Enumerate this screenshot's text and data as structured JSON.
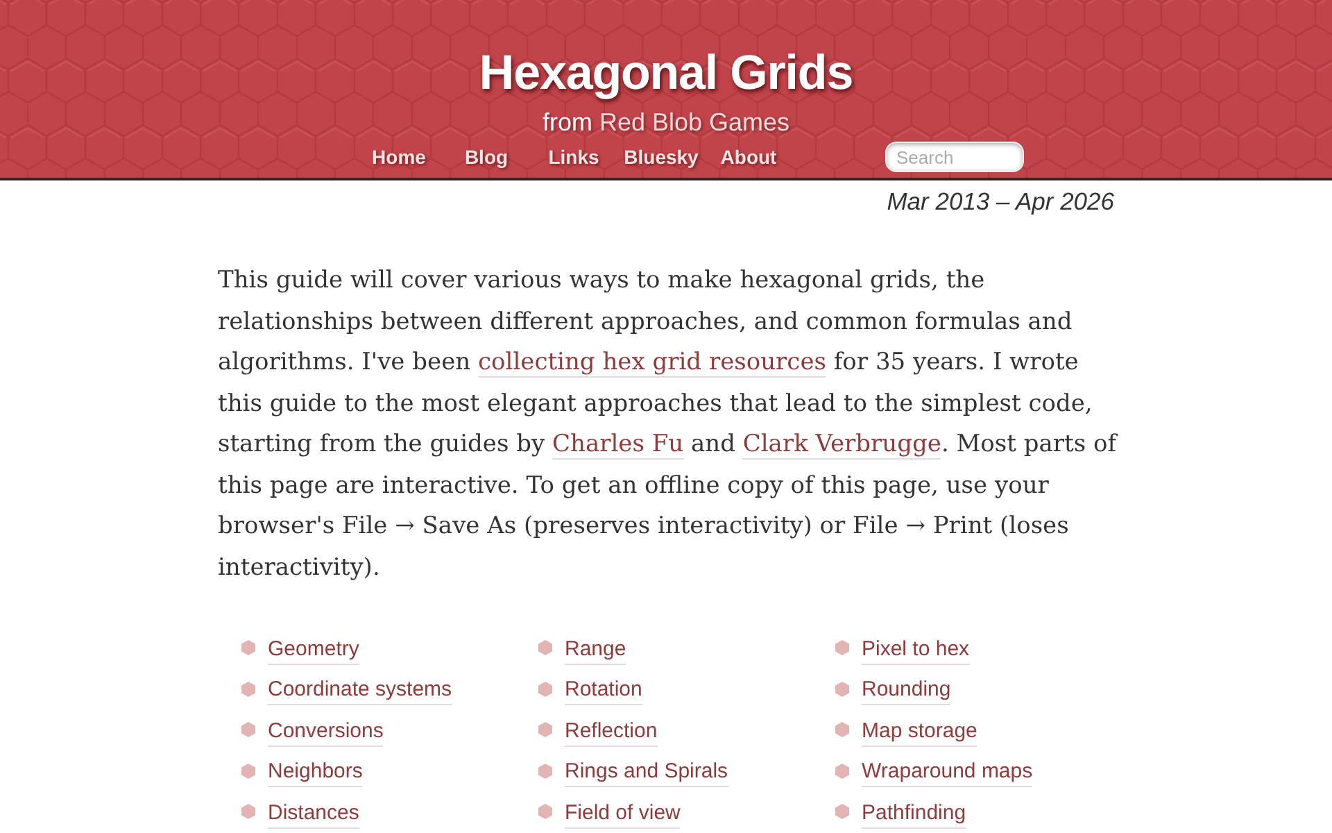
{
  "header": {
    "title": "Hexagonal Grids",
    "subtitle": [
      {
        "kind": "text",
        "text": "from "
      },
      {
        "kind": "link",
        "text": "Red Blob Games"
      }
    ],
    "nav": [
      "Home",
      "Blog",
      "Links",
      "Bluesky",
      "About"
    ],
    "search": {
      "placeholder": "Search"
    }
  },
  "date_range": "Mar 2013 – Apr 2026",
  "intro": [
    {
      "kind": "text",
      "text": "This guide will cover various ways to make hexagonal grids, the relationships between different approaches, and common formulas and algorithms. I've been "
    },
    {
      "kind": "link",
      "text": "collecting hex grid resources"
    },
    {
      "kind": "text",
      "text": " for 35 years. I wrote this guide to the most elegant approaches that lead to the simplest code, starting from the guides by "
    },
    {
      "kind": "link",
      "text": "Charles Fu"
    },
    {
      "kind": "text",
      "text": " and "
    },
    {
      "kind": "link",
      "text": "Clark Verbrugge"
    },
    {
      "kind": "text",
      "text": ". Most parts of this page are interactive. To get an offline copy of this page, use your browser's File → Save As (preserves interactivity) or File → Print (loses interactivity)."
    }
  ],
  "contents": {
    "columns": [
      [
        "Geometry",
        "Coordinate systems",
        "Conversions",
        "Neighbors",
        "Distances"
      ],
      [
        "Range",
        "Rotation",
        "Reflection",
        "Rings and Spirals",
        "Field of view"
      ],
      [
        "Pixel to hex",
        "Rounding",
        "Map storage",
        "Wraparound maps",
        "Pathfinding"
      ]
    ]
  }
}
